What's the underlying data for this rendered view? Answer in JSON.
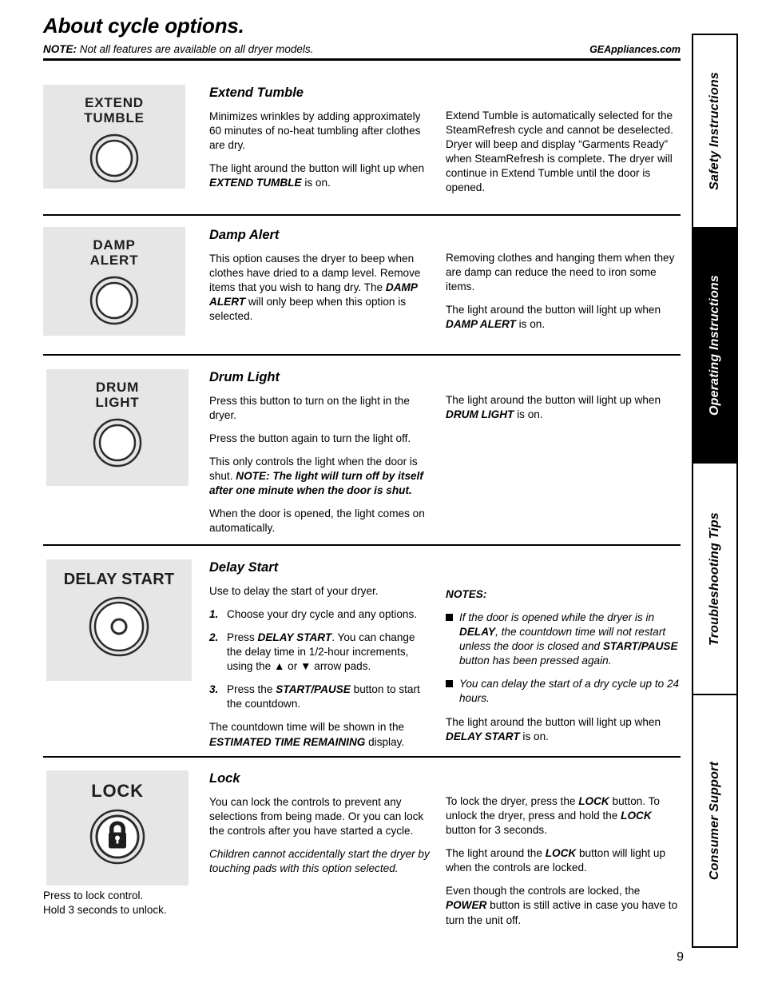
{
  "header": {
    "title": "About cycle options.",
    "note_label": "NOTE:",
    "note_text": " Not all features are available on all dryer models.",
    "site_link": "GEAppliances.com"
  },
  "sections": [
    {
      "id": "extend-tumble",
      "control_label": "EXTEND\nTUMBLE",
      "heading": "Extend Tumble",
      "middle_paragraphs": [
        "Minimizes wrinkles by adding approximately 60 minutes of no-heat tumbling after clothes are dry.",
        "The light around the button will light up when EXTEND TUMBLE is on."
      ],
      "right_paragraphs": [
        "Extend Tumble is automatically selected for the SteamRefresh cycle and cannot be deselected. Dryer will beep and display “Garments Ready” when SteamRefresh is complete. The dryer will continue in Extend Tumble until the door is opened."
      ]
    },
    {
      "id": "damp-alert",
      "control_label": "DAMP\nALERT",
      "heading": "Damp Alert",
      "middle_paragraphs": [
        "This option causes the dryer to beep when clothes have dried to a damp level. Remove items that you wish to hang dry. The DAMP ALERT will only beep when this option is selected."
      ],
      "right_paragraphs": [
        "Removing clothes and hanging them when they are damp can reduce the need to iron some items.",
        "The light around the button will light up when DAMP ALERT is on."
      ]
    },
    {
      "id": "drum-light",
      "control_label": "DRUM\nLIGHT",
      "heading": "Drum Light",
      "middle_paragraphs": [
        "Press this button to turn on the light in the dryer.",
        "Press the button again to turn the light off.",
        "This only controls the light when the door is shut. NOTE: The light will turn off by itself after one minute when the door is shut.",
        "When the door is opened, the light comes on automatically."
      ],
      "right_paragraphs": [
        "The light around the button will light up when DRUM LIGHT is on."
      ]
    },
    {
      "id": "delay-start",
      "control_label": "DELAY START",
      "heading": "Delay Start",
      "intro": "Use to delay the start of your dryer.",
      "steps": [
        {
          "num": "1.",
          "text": "Choose your dry cycle and any options."
        },
        {
          "num": "2.",
          "text": "Press DELAY START. You can change the delay time in 1/2-hour increments, using the ▲ or ▼ arrow pads."
        },
        {
          "num": "3.",
          "text": "Press the START/PAUSE button to start the countdown."
        }
      ],
      "closing": "The countdown time will be shown in the ESTIMATED TIME REMAINING display.",
      "notes_title": "NOTES:",
      "notes": [
        "If the door is opened while the dryer is in DELAY, the countdown time will not restart unless the door is closed and START/PAUSE button has been pressed again.",
        "You can delay the start of a dry cycle up to 24 hours."
      ],
      "right_closing": "The light around the button will light up when DELAY START is on."
    },
    {
      "id": "lock",
      "control_label": "LOCK",
      "caption": "Press to lock control.\nHold 3 seconds to unlock.",
      "heading": "Lock",
      "middle_paragraphs": [
        "You can lock the controls to prevent any selections from being made. Or you can lock the controls after you have started a cycle.",
        "Children cannot accidentally start the dryer by touching pads with this option selected."
      ],
      "right_paragraphs": [
        "To lock the dryer, press the LOCK button. To unlock the dryer, press and hold the LOCK button for 3 seconds.",
        "The light around the LOCK button will light up when the controls are locked.",
        "Even though the controls are locked, the POWER button is still active in case you have to turn the unit off."
      ]
    }
  ],
  "sidebar": {
    "tabs": [
      {
        "label": "Safety Instructions",
        "active": false
      },
      {
        "label": "Operating Instructions",
        "active": true
      },
      {
        "label": "Troubleshooting Tips",
        "active": false
      },
      {
        "label": "Consumer Support",
        "active": false
      }
    ]
  },
  "page_number": "9",
  "colors": {
    "control_panel_bg": "#e6e6e6",
    "active_tab_bg": "#000000",
    "text": "#000000"
  }
}
